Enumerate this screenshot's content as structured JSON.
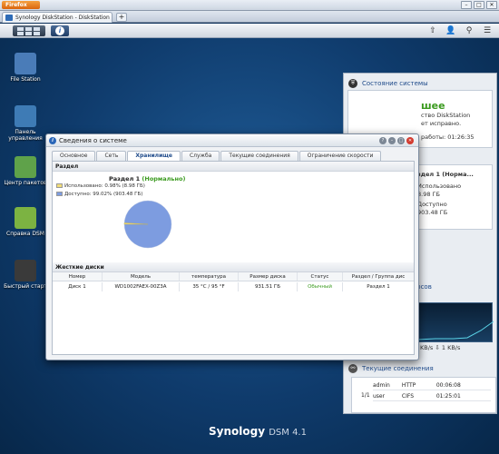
{
  "browser": {
    "menu_button": "Firefox",
    "tab_title": "Synology DiskStation - DiskStation",
    "new_tab": "+",
    "win_controls": [
      "–",
      "□",
      "✕"
    ]
  },
  "taskbar": {
    "info_glyph": "i",
    "right_icons": [
      "⇧",
      "👤",
      "⚲",
      "☰"
    ]
  },
  "desktop_icons": [
    {
      "label": "File Station",
      "color": "#4a7cb8"
    },
    {
      "label": "Панель управления",
      "color": "#3e7bb5"
    },
    {
      "label": "Центр пакетов",
      "color": "#5fa24a"
    },
    {
      "label": "Справка DSM",
      "color": "#7cb342"
    },
    {
      "label": "Быстрый старт",
      "color": "#3a3a3a"
    }
  ],
  "brand": {
    "name": "Synology",
    "version": "DSM 4.1"
  },
  "widgets": {
    "system_status": {
      "title": "Состояние системы",
      "status": "шее",
      "line1": "ство DiskStation",
      "line2": "ет исправно.",
      "uptime": "работы: 01:26:35"
    },
    "storage": {
      "volume": "здел 1 (Норма...",
      "used_label": "Использовано",
      "used_value": "8.98 ГБ",
      "free_label": "Доступно",
      "free_value": "903.48 ГБ"
    },
    "resources": {
      "title": "урсов",
      "speed": "KB/s ⇩ 1 KB/s"
    },
    "connections": {
      "title": "Текущие соединения",
      "page": "1/1",
      "rows": [
        {
          "user": "admin",
          "type": "HTTP",
          "time": "00:06:08"
        },
        {
          "user": "user",
          "type": "CIFS",
          "time": "01:25:01"
        }
      ]
    }
  },
  "window": {
    "title": "Сведения о системе",
    "tabs": [
      "Основное",
      "Сеть",
      "Хранилище",
      "Служба",
      "Текущие соединения",
      "Ограничение скорости"
    ],
    "active_tab": 2,
    "section_volume": "Раздел",
    "volume_name": "Раздел 1",
    "volume_status": "(Нормально)",
    "used_legend": "Использовано: 0.98% (8.98 ГБ)",
    "free_legend": "Доступно: 99.02% (903.48 ГБ)",
    "usage": {
      "used_pct": 0.98,
      "free_pct": 99.02
    },
    "colors": {
      "used": "#f1dc78",
      "free": "#7d9ce0"
    },
    "section_disks": "Жесткие диски",
    "disk_columns": [
      "Номер",
      "Модель",
      "температура",
      "Размер диска",
      "Статус",
      "Раздел / Группа дис"
    ],
    "disks": [
      {
        "num": "Диск 1",
        "model": "WD1002FAEX-00Z3A",
        "temp": "35 °C / 95 °F",
        "size": "931.51 ГБ",
        "status": "Обычный",
        "volume": "Раздел 1"
      }
    ]
  }
}
